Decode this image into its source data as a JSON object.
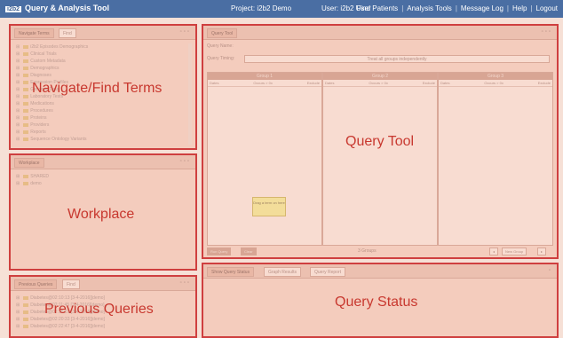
{
  "topbar": {
    "logo": "i2b2",
    "app_title": "Query & Analysis Tool",
    "project": "Project: i2b2 Demo",
    "user": "User: i2b2 User",
    "nav": [
      "Find Patients",
      "Analysis Tools",
      "Message Log",
      "Help",
      "Logout"
    ]
  },
  "navigate": {
    "tabs": [
      "Navigate Terms",
      "Find"
    ],
    "label": "Navigate/Find Terms",
    "tree": [
      "i2b2 Episodes Demographics",
      "Clinical Trials",
      "Custom Metadata",
      "Demographics",
      "Diagnoses",
      "Expression Profiles",
      "Genomic Data",
      "Laboratory Tests",
      "Medications",
      "Procedures",
      "Proteins",
      "Providers",
      "Reports",
      "Sequence Ontology Variants"
    ]
  },
  "workplace": {
    "tab": "Workplace",
    "label": "Workplace",
    "tree": [
      "SHARED",
      "demo"
    ]
  },
  "previous": {
    "tabs": [
      "Previous Queries",
      "Find"
    ],
    "label": "Previous Queries",
    "tree": [
      "Diabetes@02:10:13 [3-4-2016][demo]",
      "Diabetes@02:11:45 [3-4-2016][demo]",
      "Diabetes@02:15:01 [3-4-2016][demo]",
      "Diabetes@02:20:33 [3-4-2016][demo]",
      "Diabetes@02:22:47 [3-4-2016][demo]"
    ]
  },
  "query_tool": {
    "tab": "Query Tool",
    "label": "Query Tool",
    "name_label": "Query Name:",
    "timing_label": "Query Timing:",
    "timing_value": "Treat all groups independently",
    "groups": [
      "Group 1",
      "Group 2",
      "Group 3"
    ],
    "columns": [
      "Dates",
      "Occurs > 0x",
      "Exclude"
    ],
    "drop_hint": "Drag a term on here",
    "run_button": "Run Query",
    "clear_button": "Clear",
    "groups_count": "3 Groups",
    "new_group_button": "New Group"
  },
  "query_status": {
    "tabs": [
      "Show Query Status",
      "Graph Results",
      "Query Report"
    ],
    "label": "Query Status"
  }
}
